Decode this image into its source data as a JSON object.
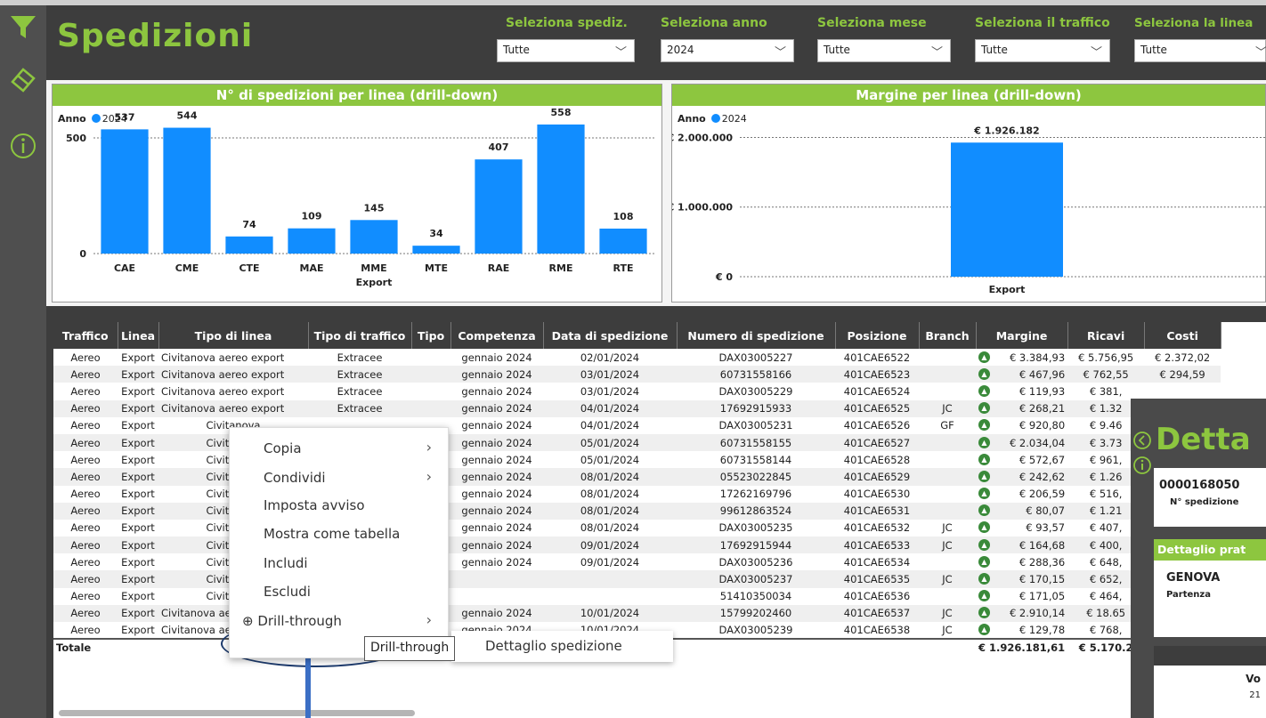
{
  "header": {
    "title": "Spedizioni",
    "slicers": [
      {
        "label": "Seleziona spediz.",
        "value": "Tutte"
      },
      {
        "label": "Seleziona anno",
        "value": "2024"
      },
      {
        "label": "Seleziona mese",
        "value": "Tutte"
      },
      {
        "label": "Seleziona il traffico",
        "value": "Tutte"
      },
      {
        "label": "Seleziona la linea",
        "value": "Tutte"
      }
    ]
  },
  "colors": {
    "accent": "#8dc63f",
    "bar": "#118dff",
    "dark": "#3d3d3d"
  },
  "chart_data": [
    {
      "type": "bar",
      "title": "N° di spedizioni per linea (drill-down)",
      "legend_title": "Anno",
      "series": [
        {
          "name": "2024",
          "values": [
            537,
            544,
            74,
            109,
            145,
            34,
            407,
            558,
            108
          ]
        }
      ],
      "categories": [
        "CAE",
        "CME",
        "CTE",
        "MAE",
        "MME",
        "MTE",
        "RAE",
        "RME",
        "RTE"
      ],
      "xlabel": "Export",
      "yticks": [
        "0",
        "500"
      ],
      "ylim": [
        0,
        600
      ]
    },
    {
      "type": "bar",
      "title": "Margine per linea (drill-down)",
      "legend_title": "Anno",
      "series": [
        {
          "name": "2024",
          "values": [
            1926182
          ]
        }
      ],
      "data_labels": [
        "€ 1.926.182"
      ],
      "categories": [
        "Export"
      ],
      "yticks": [
        "€ 0",
        "€ 1.000.000",
        "€ 2.000.000"
      ],
      "ylim": [
        0,
        2300000
      ]
    }
  ],
  "table": {
    "headers": [
      "Traffico",
      "Linea",
      "Tipo di linea",
      "Tipo di traffico",
      "Tipo",
      "Competenza",
      "Data di spedizione",
      "Numero di spedizione",
      "Posizione",
      "Branch",
      "Margine",
      "Ricavi",
      "Costi"
    ],
    "rows": [
      [
        "Aereo",
        "Export",
        "Civitanova aereo export",
        "Extracee",
        "",
        "gennaio 2024",
        "02/01/2024",
        "DAX03005227",
        "401CAE6522",
        "",
        "€ 3.384,93",
        "€ 5.756,95",
        "€ 2.372,02"
      ],
      [
        "Aereo",
        "Export",
        "Civitanova aereo export",
        "Extracee",
        "",
        "gennaio 2024",
        "03/01/2024",
        "60731558166",
        "401CAE6523",
        "",
        "€ 467,96",
        "€ 762,55",
        "€ 294,59"
      ],
      [
        "Aereo",
        "Export",
        "Civitanova aereo export",
        "Extracee",
        "",
        "gennaio 2024",
        "03/01/2024",
        "DAX03005229",
        "401CAE6524",
        "",
        "€ 119,93",
        "€ 381,",
        ""
      ],
      [
        "Aereo",
        "Export",
        "Civitanova aereo export",
        "Extracee",
        "",
        "gennaio 2024",
        "04/01/2024",
        "17692915933",
        "401CAE6525",
        "JC",
        "€ 268,21",
        "€ 1.32",
        ""
      ],
      [
        "Aereo",
        "Export",
        "Civitanova",
        "",
        "",
        "gennaio 2024",
        "04/01/2024",
        "DAX03005231",
        "401CAE6526",
        "GF",
        "€ 920,80",
        "€ 9.46",
        ""
      ],
      [
        "Aereo",
        "Export",
        "Civitanova",
        "",
        "",
        "gennaio 2024",
        "05/01/2024",
        "60731558155",
        "401CAE6527",
        "",
        "€ 2.034,04",
        "€ 3.73",
        ""
      ],
      [
        "Aereo",
        "Export",
        "Civitanova",
        "",
        "",
        "gennaio 2024",
        "05/01/2024",
        "60731558144",
        "401CAE6528",
        "",
        "€ 572,67",
        "€ 961,",
        ""
      ],
      [
        "Aereo",
        "Export",
        "Civitanova",
        "",
        "",
        "gennaio 2024",
        "08/01/2024",
        "05523022845",
        "401CAE6529",
        "",
        "€ 242,62",
        "€ 1.26",
        ""
      ],
      [
        "Aereo",
        "Export",
        "Civitanova",
        "",
        "",
        "gennaio 2024",
        "08/01/2024",
        "17262169796",
        "401CAE6530",
        "",
        "€ 206,59",
        "€ 516,",
        ""
      ],
      [
        "Aereo",
        "Export",
        "Civitanova",
        "",
        "",
        "gennaio 2024",
        "08/01/2024",
        "99612863524",
        "401CAE6531",
        "",
        "€ 80,07",
        "€ 1.21",
        ""
      ],
      [
        "Aereo",
        "Export",
        "Civitanova",
        "",
        "",
        "gennaio 2024",
        "08/01/2024",
        "DAX03005235",
        "401CAE6532",
        "JC",
        "€ 93,57",
        "€ 407,",
        ""
      ],
      [
        "Aereo",
        "Export",
        "Civitanova",
        "",
        "",
        "gennaio 2024",
        "09/01/2024",
        "17692915944",
        "401CAE6533",
        "JC",
        "€ 164,68",
        "€ 400,",
        ""
      ],
      [
        "Aereo",
        "Export",
        "Civitanova",
        "",
        "",
        "gennaio 2024",
        "09/01/2024",
        "DAX03005236",
        "401CAE6534",
        "",
        "€ 288,36",
        "€ 648,",
        ""
      ],
      [
        "Aereo",
        "Export",
        "Civitanova",
        "",
        "",
        "",
        "",
        "DAX03005237",
        "401CAE6535",
        "JC",
        "€ 170,15",
        "€ 652,",
        ""
      ],
      [
        "Aereo",
        "Export",
        "Civitanova",
        "",
        "",
        "",
        "",
        "51410350034",
        "401CAE6536",
        "",
        "€ 171,05",
        "€ 464,",
        ""
      ],
      [
        "Aereo",
        "Export",
        "Civitanova aereo export",
        "Extra",
        "",
        "gennaio 2024",
        "10/01/2024",
        "15799202460",
        "401CAE6537",
        "JC",
        "€ 2.910,14",
        "€ 18.65",
        ""
      ],
      [
        "Aereo",
        "Export",
        "Civitanova aereo export",
        "Extracee",
        "",
        "gennaio 2024",
        "10/01/2024",
        "DAX03005239",
        "401CAE6538",
        "JC",
        "€ 129,78",
        "€ 768,",
        ""
      ]
    ],
    "total_label": "Totale",
    "total_margine": "€ 1.926.181,61",
    "total_ricavi": "€ 5.170.2"
  },
  "context_menu": {
    "items": [
      {
        "label": "Copia",
        "submenu": true
      },
      {
        "label": "Condividi",
        "submenu": true
      },
      {
        "label": "Imposta avviso",
        "submenu": false
      },
      {
        "label": "Mostra come tabella",
        "submenu": false
      },
      {
        "label": "Includi",
        "submenu": false
      },
      {
        "label": "Escludi",
        "submenu": false
      },
      {
        "label": "Drill-through",
        "submenu": true
      }
    ],
    "submenu_item": "Dettaglio spedizione",
    "tooltip": "Drill-through"
  },
  "detail_panel": {
    "title": "Detta",
    "number": "0000168050",
    "number_label": "N° spedizione",
    "section": "Dettaglio prat",
    "city": "GENOVA",
    "city_label": "Partenza",
    "col": "Vo",
    "col_val": "21"
  }
}
